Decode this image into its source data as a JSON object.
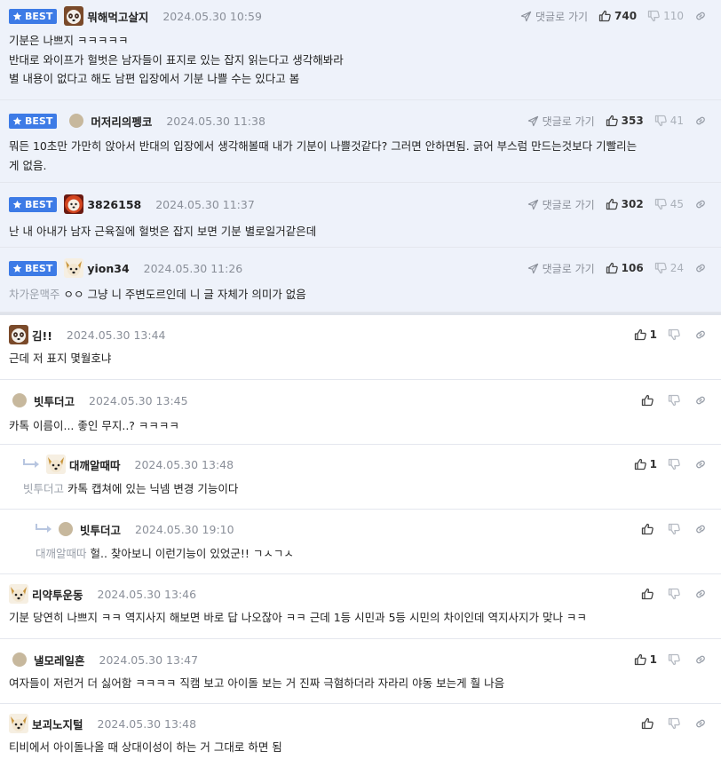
{
  "labels": {
    "best": "BEST",
    "goto": "댓글로 가기"
  },
  "best_comments": [
    {
      "nick": "뭐해먹고살지",
      "date": "2024.05.30 10:59",
      "up": "740",
      "down": "110",
      "text": "기분은 나쁘지 ㅋㅋㅋㅋㅋ\n반대로 와이프가 헐벗은 남자들이 표지로 있는 잡지 읽는다고 생각해봐라\n별 내용이 없다고 해도 남편 입장에서 기분 나쁠 수는 있다고 봄"
    },
    {
      "nick": "머저리의펭코",
      "date": "2024.05.30 11:38",
      "up": "353",
      "down": "41",
      "text": "뭐든 10초만 가만히 앉아서 반대의 입장에서 생각해볼때 내가 기분이 나쁠것같다? 그러면 안하면됨. 긁어 부스럼 만드는것보다 기빨리는\n게 없음."
    },
    {
      "nick": "3826158",
      "date": "2024.05.30 11:37",
      "up": "302",
      "down": "45",
      "text": "난 내 아내가 남자 근육질에 헐벗은 잡지 보면 기분 별로일거같은데"
    },
    {
      "nick": "yion34",
      "date": "2024.05.30 11:26",
      "up": "106",
      "down": "24",
      "mention": "차가운맥주",
      "text": "ㅇㅇ 그냥 니 주변도르인데 니 글 자체가 의미가 없음"
    }
  ],
  "comments": [
    {
      "nick": "김!!",
      "date": "2024.05.30 13:44",
      "up": "1",
      "text": "근데 저 표지 몇월호냐"
    },
    {
      "nick": "빗투더고",
      "date": "2024.05.30 13:45",
      "up": "",
      "text": "카톡 이름이... 좋인 무지..? ㅋㅋㅋㅋ"
    },
    {
      "nick": "대깨알때따",
      "date": "2024.05.30 13:48",
      "up": "1",
      "mention": "빗투더고",
      "text": "카톡 캡쳐에 있는 닉넴 변경 기능이다"
    },
    {
      "nick": "빗투더고",
      "date": "2024.05.30 19:10",
      "up": "",
      "mention": "대깨알때따",
      "text": "헐.. 찾아보니 이런기능이 있었군!! ㄱㅅㄱㅅ"
    },
    {
      "nick": "리약투운동",
      "date": "2024.05.30 13:46",
      "up": "",
      "text": "기분 당연히 나쁘지 ㅋㅋ 역지사지 해보면 바로 답 나오잖아 ㅋㅋ 근데 1등 시민과 5등 시민의 차이인데 역지사지가 맞나 ㅋㅋ"
    },
    {
      "nick": "낼모레일흔",
      "date": "2024.05.30 13:47",
      "up": "1",
      "text": "여자들이 저런거 더 싫어함 ㅋㅋㅋㅋ 직캠 보고 아이돌 보는 거 진짜 극혐하더라 자라리 야동 보는게 훨 나음"
    },
    {
      "nick": "보괴노지털",
      "date": "2024.05.30 13:48",
      "up": "",
      "text": "티비에서 아이돌나올 때 상대이성이 하는 거 그대로 하면 됨"
    }
  ]
}
